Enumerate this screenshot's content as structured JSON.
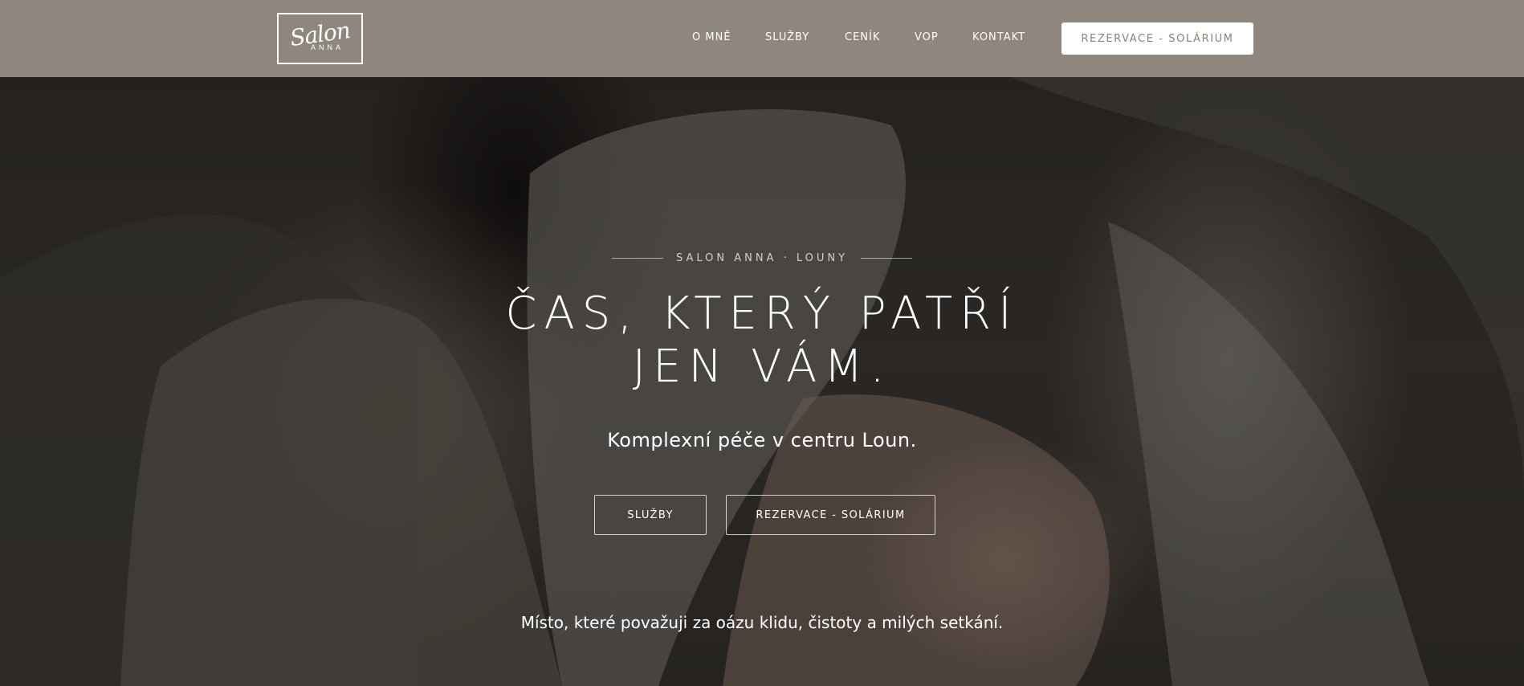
{
  "header": {
    "logo_script": "Salon",
    "logo_sub": "ANNA",
    "nav": [
      "O MNĚ",
      "SLUŽBY",
      "CENÍK",
      "VOP",
      "KONTAKT"
    ],
    "cta_label": "REZERVACE - SOLÁRIUM",
    "background": "#8f877d"
  },
  "hero": {
    "kicker": "SALON ANNA · LOUNY",
    "title_line1": "ČAS, KTERÝ PATŘÍ",
    "title_line2": "JEN VÁM.",
    "subtitle": "Komplexní péče v centru Loun.",
    "button_services": "SLUŽBY",
    "button_booking": "REZERVACE - SOLÁRIUM",
    "tagline": "Místo, které považuji za oázu klidu, čistoty a milých setkání."
  }
}
